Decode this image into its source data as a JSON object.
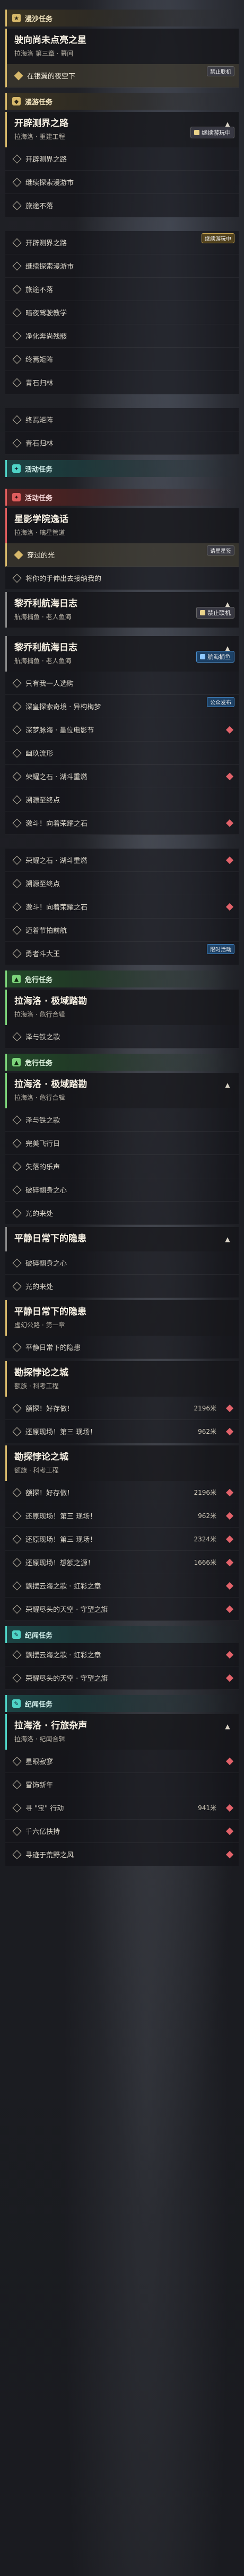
{
  "s1": {
    "header": "漫沙任务",
    "quest": {
      "title": "驶向尚未点亮之星",
      "sub": "拉海洛 第三章 · 幕间"
    },
    "tasks": [
      {
        "label": "在银翼的夜空下"
      }
    ],
    "tag_ban": "禁止联机"
  },
  "s2": {
    "header": "漫游任务",
    "quest": {
      "title": "开辟测界之路",
      "sub": "拉海洛 · 重建工程"
    },
    "tasks": [
      {
        "label": "开辟测界之路"
      },
      {
        "label": "继续探索漫游市"
      },
      {
        "label": "旅途不落"
      }
    ],
    "tag": "继续游玩中"
  },
  "s3": {
    "tasks": [
      {
        "label": "开辟测界之路"
      },
      {
        "label": "继续探索漫游市"
      },
      {
        "label": "旅途不落"
      },
      {
        "label": "暗夜驾驶教学"
      },
      {
        "label": "净化奔尚残骸"
      },
      {
        "label": "终焉矩阵"
      },
      {
        "label": "青石归林"
      }
    ],
    "tag": "继续游玩中"
  },
  "s4": {
    "tasks": [
      {
        "label": "终焉矩阵"
      },
      {
        "label": "青石归林"
      }
    ]
  },
  "s5": {
    "header": "活动任务",
    "quest": {
      "title": "活动任务"
    }
  },
  "s6": {
    "header": "活动任务",
    "quest": {
      "title": "星影学院逸话",
      "sub": "拉海洛 · 璃星管道"
    },
    "tasks": [
      {
        "label": "穿过的光"
      },
      {
        "label": "将你的手伸出去接纳我的"
      }
    ],
    "tag": "请星星签"
  },
  "s7": {
    "quest": {
      "title": "黎乔利航海日志",
      "sub": "航海捕鱼 · 老人鱼海"
    },
    "tag_ban": "禁止联机"
  },
  "s8": {
    "quest": {
      "title": "黎乔利航海日志",
      "sub": "航海捕鱼 · 老人鱼海"
    },
    "tasks": [
      {
        "label": "只有我一人选购"
      },
      {
        "label": "深皇探索奇境 · 异构梅梦"
      },
      {
        "label": "深梦脉海 · 量位电影节"
      },
      {
        "label": "幽玖流形"
      },
      {
        "label": "荣耀之石 · 湖斗重燃"
      },
      {
        "label": "溯源至终点"
      },
      {
        "label": "激斗！向着荣耀之石"
      }
    ],
    "tag_blue": "航海捕鱼",
    "tag_ban": "公众发布"
  },
  "s9": {
    "tasks": [
      {
        "label": "荣耀之石 · 湖斗重燃"
      },
      {
        "label": "溯源至终点"
      },
      {
        "label": "激斗！向着荣耀之石"
      },
      {
        "label": "迈着节拍前航"
      },
      {
        "label": "勇者斗大王"
      }
    ],
    "tag": "限时活动"
  },
  "s10": {
    "header": "危行任务",
    "quest": {
      "title": "拉海洛 · 极域踏勘",
      "sub": "拉海洛 · 危行合辑"
    },
    "tasks": [
      {
        "label": "泽与铁之歌"
      }
    ]
  },
  "s11": {
    "header": "危行任务",
    "quest": {
      "title": "拉海洛 · 极域踏勘",
      "sub": "拉海洛 · 危行合辑"
    },
    "tasks": [
      {
        "label": "泽与铁之歌"
      },
      {
        "label": "完美飞行日"
      },
      {
        "label": "失落的乐声"
      },
      {
        "label": "破碎翻身之心"
      },
      {
        "label": "光的来处"
      }
    ]
  },
  "s12": {
    "quest": {
      "title": "平静日常下的隐患"
    },
    "tasks": [
      {
        "label": "破碎翻身之心"
      },
      {
        "label": "光的来处"
      }
    ]
  },
  "s13": {
    "quest": {
      "title": "平静日常下的隐患",
      "sub": "虚幻公路 · 第一章"
    },
    "tasks": [
      {
        "label": "平静日常下的隐患"
      }
    ]
  },
  "s14": {
    "quest": {
      "title": "勘探悖论之城",
      "sub": "额族 · 科考工程"
    },
    "tasks": [
      {
        "label": "额探！好存做！",
        "count": "2196米"
      },
      {
        "label": "还原现场！第三 现场！",
        "count": "962米"
      }
    ]
  },
  "s15": {
    "quest": {
      "title": "勘探悖论之城",
      "sub": "额族 · 科考工程"
    },
    "tasks": [
      {
        "label": "额探！好存做！",
        "count": "2196米"
      },
      {
        "label": "还原现场！第三 现场！",
        "count": "962米"
      },
      {
        "label": "还原现场！第三 现场！",
        "count": "2324米"
      },
      {
        "label": "还原现场！想额之源！",
        "count": "1666米"
      },
      {
        "label": "飘摆云海之歌 · 虹彩之章"
      },
      {
        "label": "荣耀尽头的天空 · 守望之旗"
      }
    ]
  },
  "s16": {
    "header": "纪闻任务",
    "tasks": [
      {
        "label": "飘摆云海之歌 · 虹彩之章"
      },
      {
        "label": "荣耀尽头的天空 · 守望之旗"
      }
    ]
  },
  "s17": {
    "header": "纪闻任务",
    "quest": {
      "title": "拉海洛 · 行旅杂声",
      "sub": "拉海洛 · 纪闻合辑"
    },
    "tasks": [
      {
        "label": "星眼寂寥"
      },
      {
        "label": "雪饰新年"
      },
      {
        "label": "寻 \"宝\" 行动",
        "count": "941米"
      },
      {
        "label": "千六亿扶持"
      },
      {
        "label": "寻迹于荒野之风"
      }
    ]
  }
}
